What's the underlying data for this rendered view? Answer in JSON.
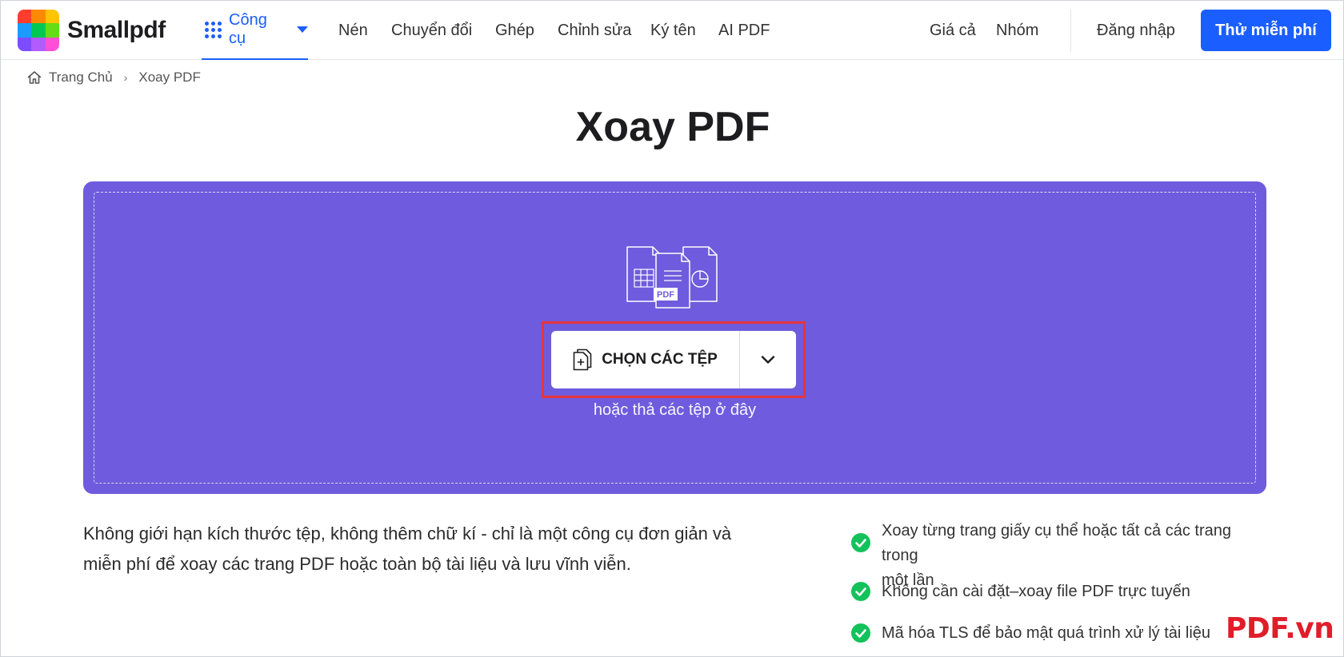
{
  "brand": {
    "name": "Smallpdf",
    "logo_colors": [
      "#ff3d2e",
      "#ff8a00",
      "#ffc400",
      "#1a9cff",
      "#00c853",
      "#64dd17",
      "#7c4dff",
      "#b15cff",
      "#ff4fd8"
    ]
  },
  "header": {
    "tools_label": "Công cụ",
    "nav": [
      "Nén",
      "Chuyển đổi",
      "Ghép",
      "Chỉnh sửa",
      "Ký tên",
      "AI PDF"
    ],
    "pricing": "Giá cả",
    "team": "Nhóm",
    "login": "Đăng nhập",
    "trial": "Thử miễn phí"
  },
  "breadcrumb": {
    "home": "Trang Chủ",
    "current": "Xoay PDF"
  },
  "page_title": "Xoay PDF",
  "dropzone": {
    "file_badge": "PDF",
    "choose_label": "CHỌN CÁC TỆP",
    "hint": "hoặc thả các tệp ở đây"
  },
  "description": {
    "line1": "Không giới hạn kích thước tệp, không thêm chữ kí - chỉ là một công cụ đơn giản và",
    "line2": "miễn phí để xoay các trang PDF hoặc toàn bộ tài liệu và lưu vĩnh viễn."
  },
  "features": [
    {
      "line1": "Xoay từng trang giấy cụ thể hoặc tất cả các trang trong",
      "line2": "một lần"
    },
    {
      "line1": "Không cần cài đặt–xoay file PDF trực tuyến",
      "line2": ""
    },
    {
      "line1": "Mã hóa TLS để bảo mật quá trình xử lý tài liệu",
      "line2": ""
    }
  ],
  "watermark": "PDF.vn",
  "colors": {
    "accent": "#1a5eff",
    "dropzone": "#6f5bdd",
    "highlight": "#e8343a",
    "check": "#13c25a",
    "watermark": "#e11d2a"
  }
}
